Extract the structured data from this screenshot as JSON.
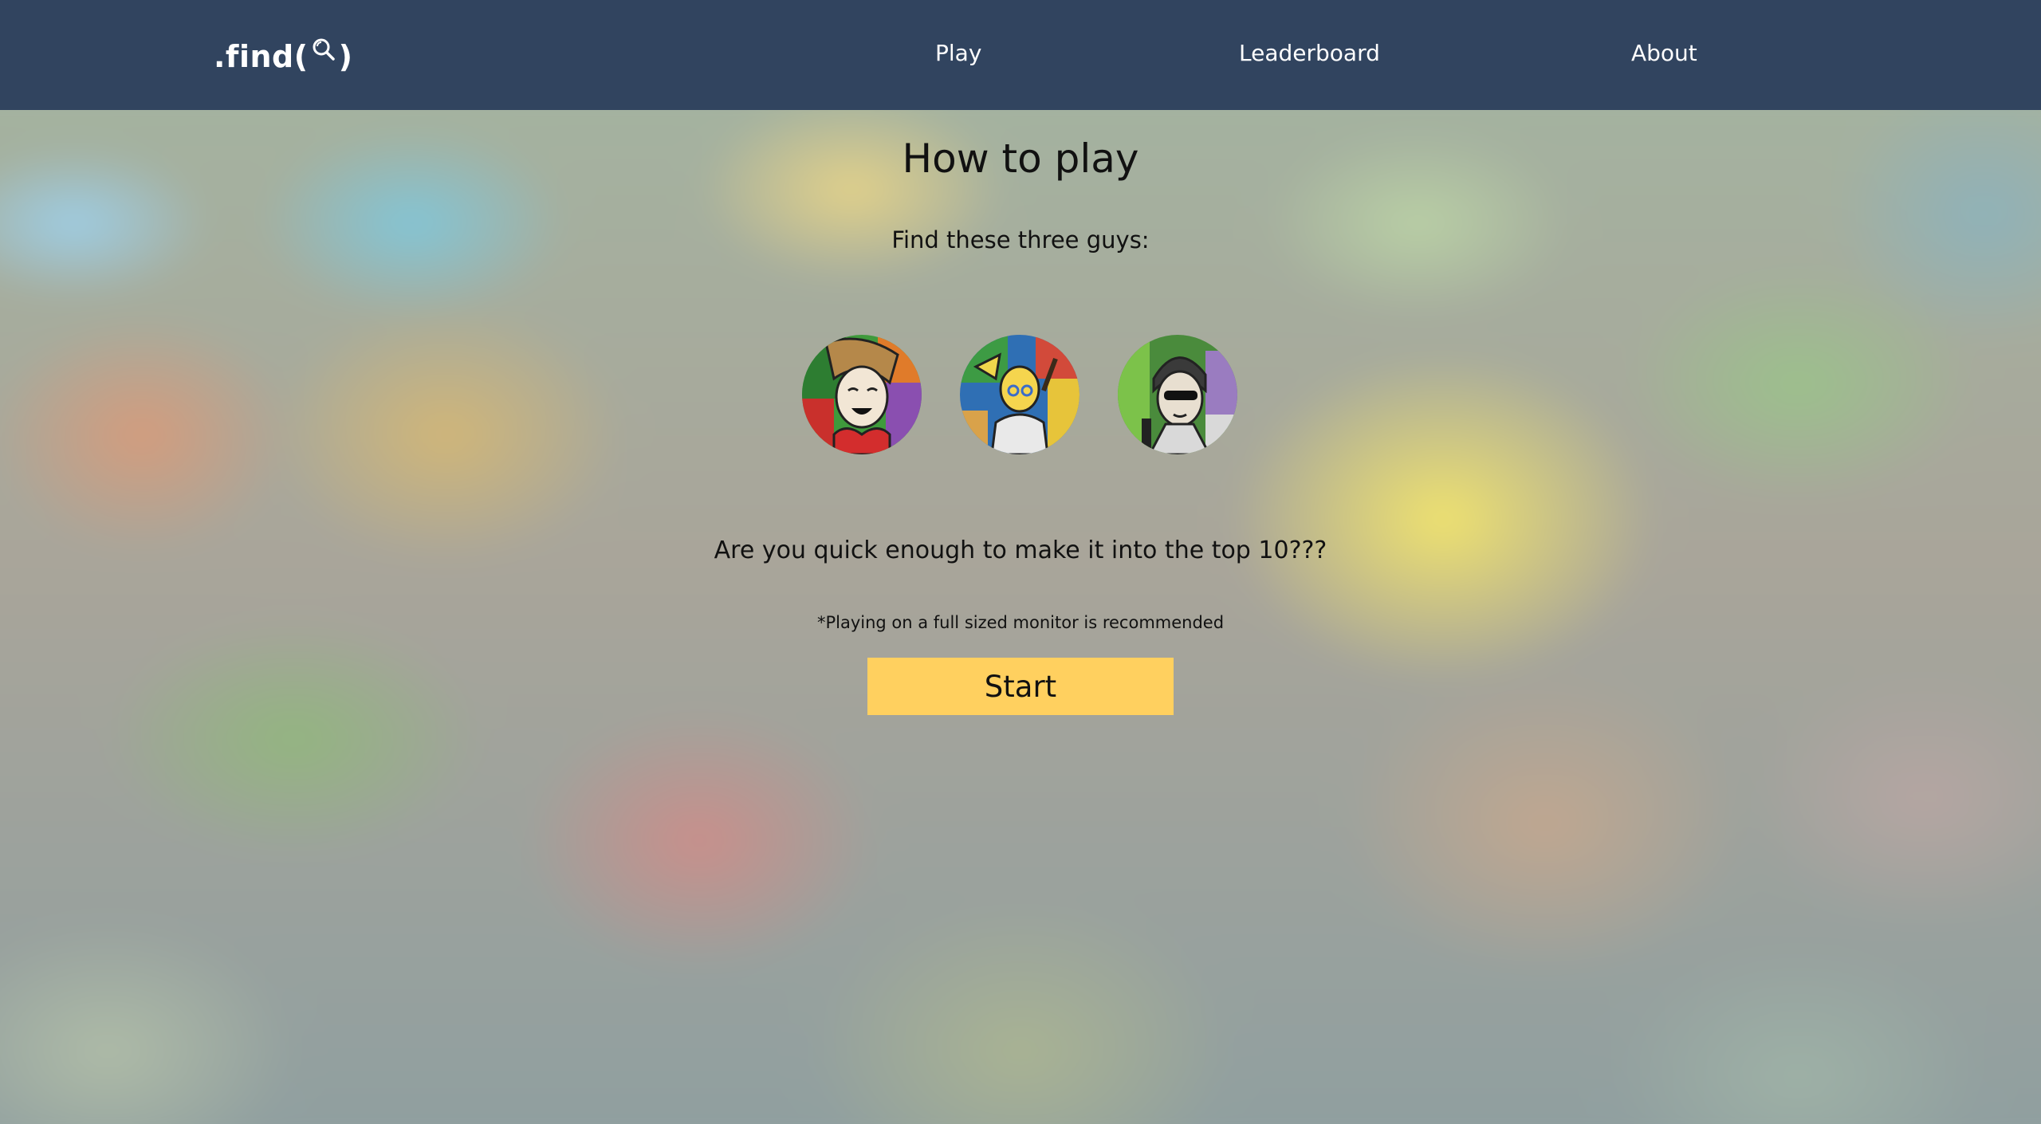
{
  "header": {
    "logo_prefix": ".find(",
    "logo_suffix": ")",
    "nav": {
      "play": "Play",
      "leaderboard": "Leaderboard",
      "about": "About"
    }
  },
  "main": {
    "title": "How to play",
    "subtitle": "Find these three guys:",
    "targets": [
      {
        "icon": "character-woman-red-top"
      },
      {
        "icon": "character-blonde-with-paintbrush"
      },
      {
        "icon": "character-man-sunglasses"
      }
    ],
    "question": "Are you quick enough to make it into the top 10???",
    "note": "*Playing on a full sized monitor is recommended",
    "start_label": "Start"
  },
  "colors": {
    "navbar": "#31445f",
    "start_button": "#ffd05f",
    "text": "#111111"
  }
}
